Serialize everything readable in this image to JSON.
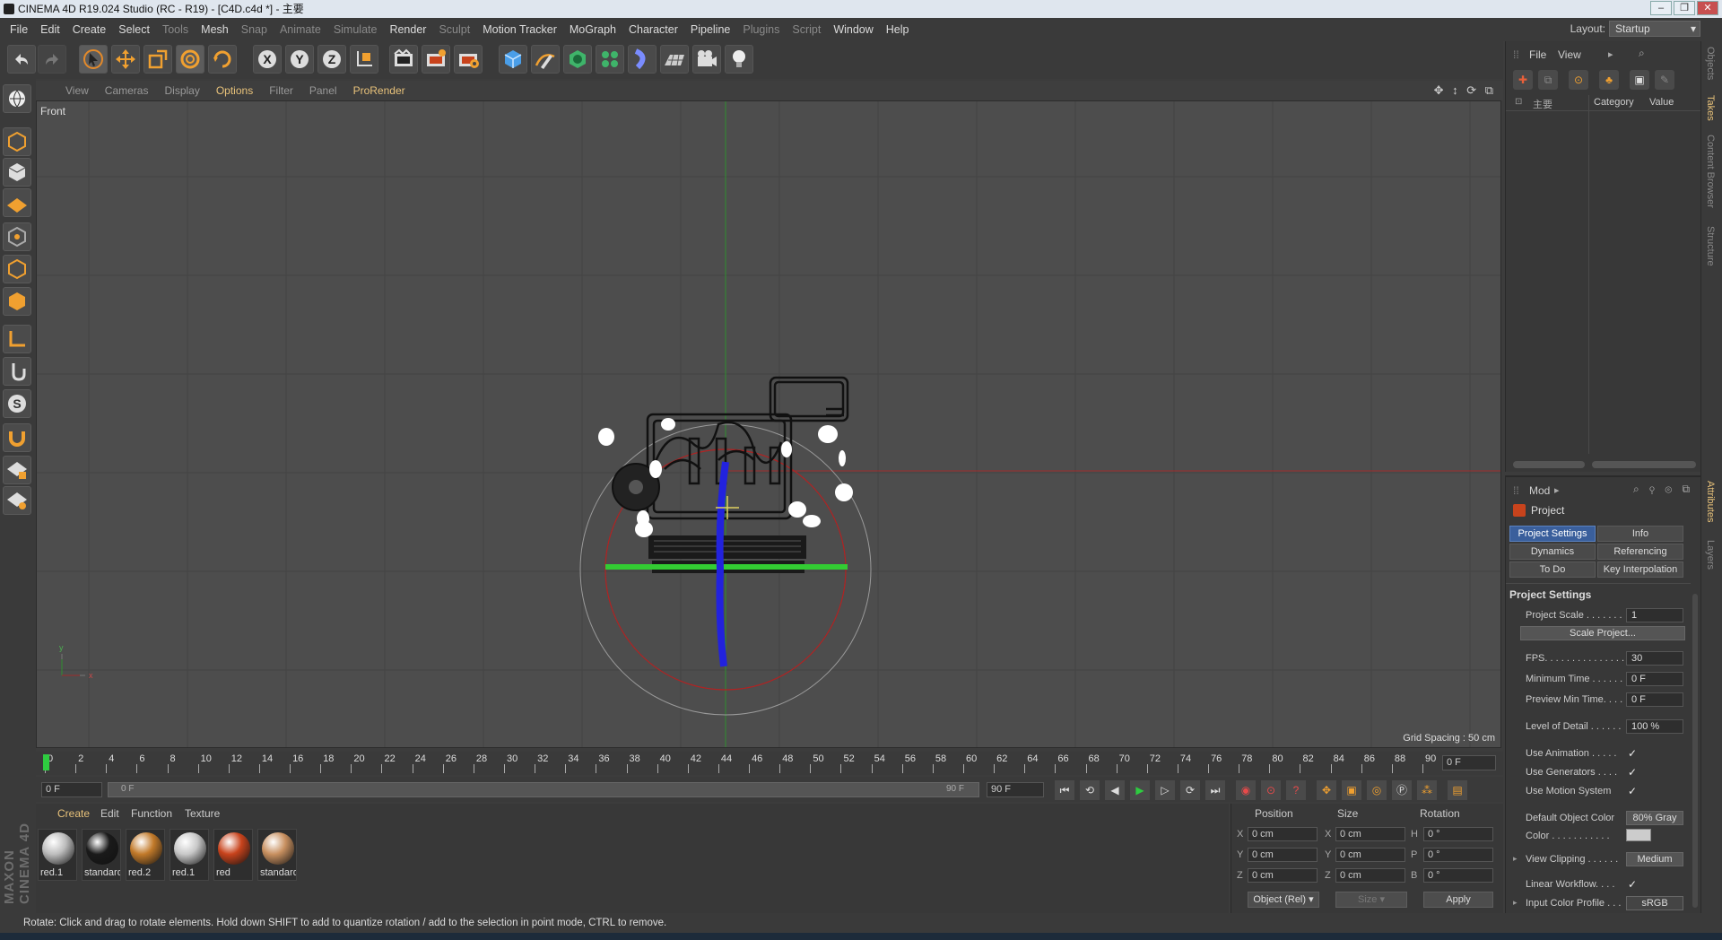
{
  "window": {
    "title": "CINEMA 4D R19.024 Studio (RC - R19) - [C4D.c4d *] - 主要"
  },
  "menubar": {
    "items": [
      "File",
      "Edit",
      "Create",
      "Select",
      "Tools",
      "Mesh",
      "Snap",
      "Animate",
      "Simulate",
      "Render",
      "Sculpt",
      "Motion Tracker",
      "MoGraph",
      "Character",
      "Pipeline",
      "Plugins",
      "Script",
      "Window",
      "Help"
    ],
    "layout_label": "Layout:",
    "layout_value": "Startup"
  },
  "viewport": {
    "menus": [
      "View",
      "Cameras",
      "Display",
      "Options",
      "Filter",
      "Panel",
      "ProRender"
    ],
    "name": "Front",
    "grid_spacing": "Grid Spacing : 50 cm",
    "axis_x": "x",
    "axis_y": "y"
  },
  "timeline": {
    "ticks": [
      "0",
      "2",
      "4",
      "6",
      "8",
      "10",
      "12",
      "14",
      "16",
      "18",
      "20",
      "22",
      "24",
      "26",
      "28",
      "30",
      "32",
      "34",
      "36",
      "38",
      "40",
      "42",
      "44",
      "46",
      "48",
      "50",
      "52",
      "54",
      "56",
      "58",
      "60",
      "62",
      "64",
      "66",
      "68",
      "70",
      "72",
      "74",
      "76",
      "78",
      "80",
      "82",
      "84",
      "86",
      "88",
      "90"
    ],
    "current_frame": "0 F",
    "start": "0 F",
    "slider_start": "0 F",
    "slider_end": "90 F",
    "end": "90 F"
  },
  "materials": {
    "menus": [
      "Create",
      "Edit",
      "Function",
      "Texture"
    ],
    "items": [
      {
        "name": "red.1",
        "color": "#bdbdbd"
      },
      {
        "name": "standard",
        "color": "#1a1a1a"
      },
      {
        "name": "red.2",
        "color": "#c27a2a"
      },
      {
        "name": "red.1",
        "color": "#c8c8c8"
      },
      {
        "name": "red",
        "color": "#c8431c"
      },
      {
        "name": "standard",
        "color": "#c89060"
      }
    ]
  },
  "coords": {
    "headers": [
      "Position",
      "Size",
      "Rotation"
    ],
    "pos": [
      {
        "axis": "X",
        "value": "0 cm"
      },
      {
        "axis": "Y",
        "value": "0 cm"
      },
      {
        "axis": "Z",
        "value": "0 cm"
      }
    ],
    "size": [
      {
        "axis": "X",
        "value": "0 cm"
      },
      {
        "axis": "Y",
        "value": "0 cm"
      },
      {
        "axis": "Z",
        "value": "0 cm"
      }
    ],
    "rot": [
      {
        "axis": "H",
        "value": "0 °"
      },
      {
        "axis": "P",
        "value": "0 °"
      },
      {
        "axis": "B",
        "value": "0 °"
      }
    ],
    "mode": "Object (Rel)",
    "size_mode": "Size",
    "apply": "Apply"
  },
  "status": "Rotate: Click and drag to rotate elements. Hold down SHIFT to add to quantize rotation / add to the selection in point mode, CTRL to remove.",
  "objects": {
    "menus": [
      "File",
      "View"
    ],
    "row": "主要",
    "col_category": "Category",
    "col_value": "Value"
  },
  "attributes": {
    "menu": "Mod",
    "project": "Project",
    "tabs": [
      "Project Settings",
      "Info",
      "Dynamics",
      "Referencing",
      "To Do",
      "Key Interpolation"
    ],
    "section": "Project Settings",
    "project_scale_label": "Project Scale . . . . . . .",
    "project_scale": "1",
    "scale_btn": "Scale Project...",
    "fps_label": "FPS. . . . . . . . . . . . . . .",
    "fps": "30",
    "min_time_label": "Minimum Time . . . . . .",
    "min_time": "0 F",
    "preview_min_label": "Preview Min Time. . . .",
    "preview_min": "0 F",
    "lod_label": "Level of Detail . . . . . .",
    "lod": "100 %",
    "use_anim": "Use Animation . . . . .",
    "use_gen": "Use Generators . . . .",
    "use_motion": "Use Motion System",
    "check": "✓",
    "def_color_label": "Default Object Color",
    "def_color": "80% Gray",
    "color_label": "Color . . . . . . . . . . .",
    "view_clip_label": "View Clipping . . . . . .",
    "view_clip": "Medium",
    "linear_label": "Linear Workflow. . . .",
    "input_profile_label": "Input Color Profile . . .",
    "input_profile": "sRGB"
  },
  "side_tabs": [
    "Objects",
    "Takes",
    "Content Browser",
    "Structure",
    "Attributes",
    "Layers"
  ],
  "logo": "MAXON CINEMA 4D"
}
